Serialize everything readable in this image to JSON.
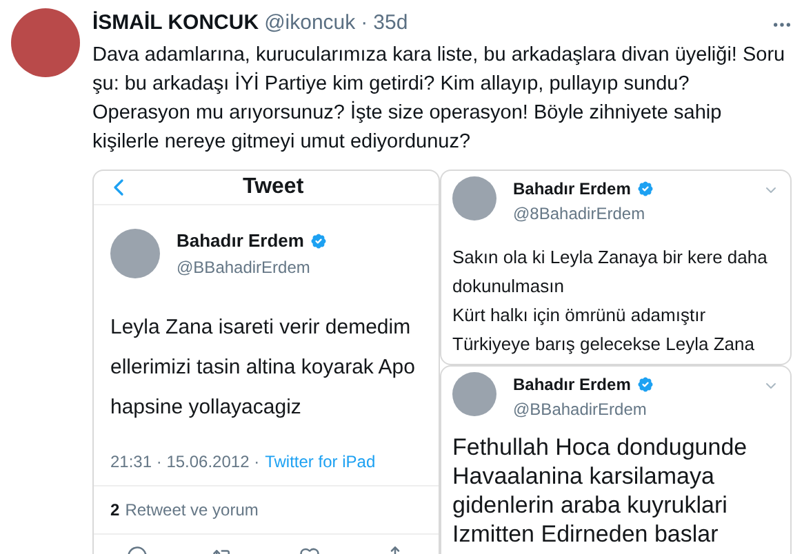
{
  "tweet": {
    "author_name": "İSMAİL KONCUK",
    "handle": "@ikoncuk",
    "separator": "·",
    "time": "35d",
    "text_lines": [
      "Dava adamlarına, kurucularımıza kara liste, bu arkadaşlara divan üyeliği! Soru",
      "şu: bu arkadaşı  İYİ Partiye kim getirdi? Kim allayıp, pullayıp sundu?",
      "Operasyon mu arıyorsunuz? İşte size operasyon! Böyle zihniyete sahip",
      "kişilerle nereye gitmeyi umut ediyordunuz?"
    ]
  },
  "screenshots": [
    {
      "kind": "detail",
      "header_title": "Tweet",
      "author_name": "Bahadır Erdem",
      "verified": true,
      "handle": "@BBahadirErdem",
      "text_lines": [
        "Leyla Zana isareti verir demedim",
        "ellerimizi tasin altina koyarak Apo",
        "hapsine yollayacagiz"
      ],
      "timestamp": "21:31 · 15.06.2012 ·",
      "source": "Twitter for iPad",
      "retweet_count": "2",
      "retweet_label": "Retweet ve yorum"
    },
    {
      "kind": "small",
      "author_name": "Bahadır Erdem",
      "verified": true,
      "handle": "@8BahadirErdem",
      "text_lines": [
        "Sakın ola ki Leyla Zanaya bir kere daha",
        "dokunulmasın",
        "Kürt halkı için ömrünü adamıştır",
        "Türkiyeye barış gelecekse Leyla Zana"
      ]
    },
    {
      "kind": "large",
      "author_name": "Bahadır Erdem",
      "verified": true,
      "handle": "@BBahadirErdem",
      "text_lines": [
        "Fethullah Hoca dondugunde",
        "Havaalanina karsilamaya",
        "gidenlerin araba kuyruklari",
        "Izmitten Edirneden baslar"
      ]
    }
  ]
}
